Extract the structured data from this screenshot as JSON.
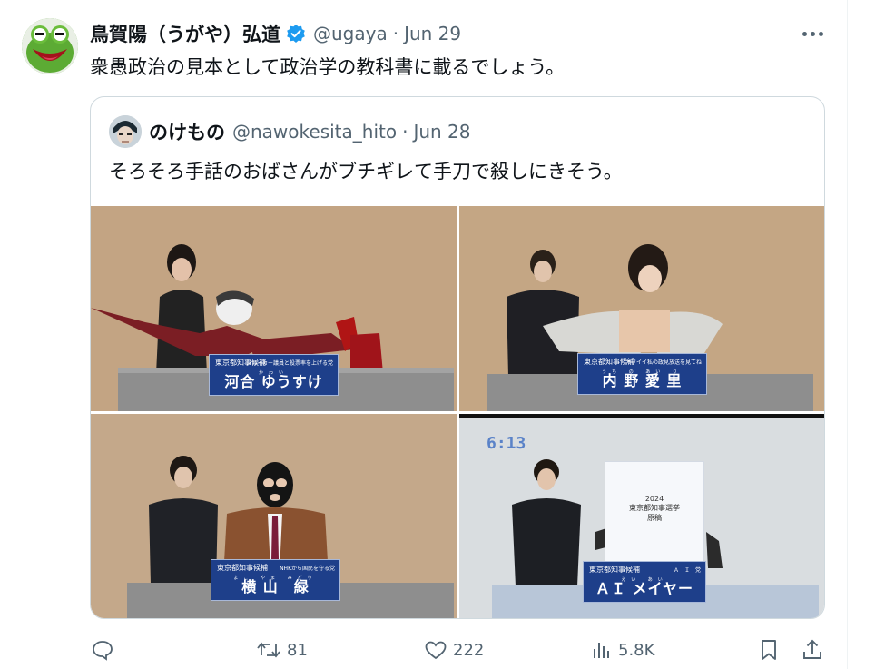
{
  "tweet": {
    "author_name": "鳥賀陽（うがや）弘道",
    "handle": "@ugaya",
    "separator": "·",
    "date": "Jun 29",
    "text": "衆愚政治の見本として政治学の教科書に載るでしょう。"
  },
  "quote": {
    "author_name": "のけもの",
    "handle": "@nawokesita_hito",
    "separator": "·",
    "date": "Jun 28",
    "text": "そろそろ手話のおばさんがブチギレて手刀で殺しにきそう。",
    "media": [
      {
        "office": "東京都知事候補",
        "party": "ジョーカー議員と投票率を上げる党",
        "ruby": "かわい",
        "name": "河合 ゆうすけ"
      },
      {
        "office": "東京都知事候補",
        "party": "カワイイ私の政見放送を見てね",
        "ruby": "うち の あい り",
        "name": "内 野 愛 里"
      },
      {
        "office": "東京都知事候補",
        "party": "NHKから国民を守る党",
        "ruby": "よこ やま みどり",
        "name": "横 山　緑"
      },
      {
        "office": "東京都知事候補",
        "party": "Ａ　Ｉ　党",
        "ruby": "えい あい",
        "name": "ＡＩ メイヤー",
        "clock": "6:13",
        "poster_year": "2024",
        "poster_title": "東京都知事選挙",
        "poster_subtitle": "原稿"
      }
    ]
  },
  "actions": {
    "reply_count": "",
    "retweet_count": "81",
    "like_count": "222",
    "views_count": "5.8K"
  },
  "colors": {
    "verified": "#1d9bf0",
    "secondary_text": "#536471",
    "border": "#cfd9de",
    "nameplate": "#1e3f8a"
  },
  "icons": [
    "verified-badge-icon",
    "more-icon",
    "reply-icon",
    "retweet-icon",
    "like-icon",
    "views-icon",
    "bookmark-icon",
    "share-icon"
  ]
}
